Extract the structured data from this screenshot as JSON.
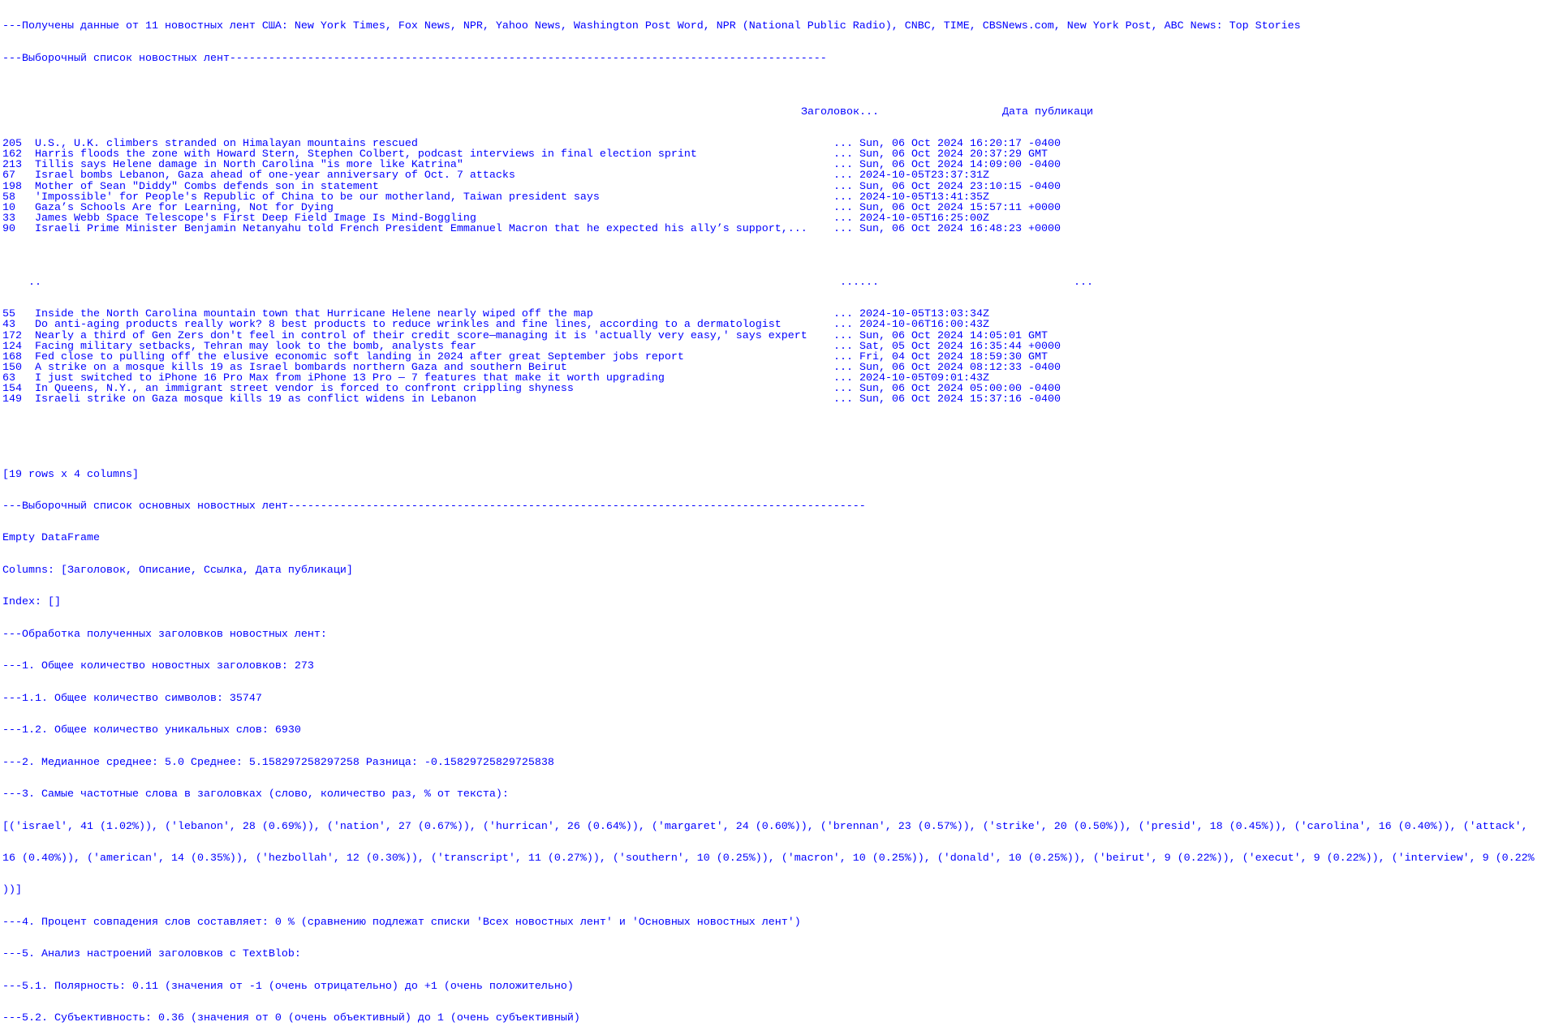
{
  "console": {
    "header_line": "---Получены данные от 11 новостных лент США: New York Times, Fox News, NPR, Yahoo News, Washington Post Word, NPR (National Public Radio), CNBC, TIME, CBSNews.com, New York Post, ABC News: Top Stories",
    "sample_list_title": "---Выборочный список новостных лент--------------------------------------------------------------------------------------------",
    "table": {
      "columns": {
        "title": "Заголовок",
        "ellipsis": "...",
        "date": "Дата публикаци"
      },
      "rows_top": [
        {
          "index": "205",
          "title": "U.S., U.K. climbers stranded on Himalayan mountains rescued",
          "ellipsis": "...",
          "date": "Sun, 06 Oct 2024 16:20:17 -0400"
        },
        {
          "index": "162",
          "title": "Harris floods the zone with Howard Stern, Stephen Colbert, podcast interviews in final election sprint",
          "ellipsis": "...",
          "date": "Sun, 06 Oct 2024 20:37:29 GMT"
        },
        {
          "index": "213",
          "title": "Tillis says Helene damage in North Carolina \"is more like Katrina\"",
          "ellipsis": "...",
          "date": "Sun, 06 Oct 2024 14:09:00 -0400"
        },
        {
          "index": "67",
          "title": "Israel bombs Lebanon, Gaza ahead of one-year anniversary of Oct. 7 attacks",
          "ellipsis": "...",
          "date": "2024-10-05T23:37:31Z"
        },
        {
          "index": "198",
          "title": "Mother of Sean \"Diddy\" Combs defends son in statement",
          "ellipsis": "...",
          "date": "Sun, 06 Oct 2024 23:10:15 -0400"
        },
        {
          "index": "58",
          "title": "'Impossible' for People's Republic of China to be our motherland, Taiwan president says",
          "ellipsis": "...",
          "date": "2024-10-05T13:41:35Z"
        },
        {
          "index": "10",
          "title": "Gaza’s Schools Are for Learning, Not for Dying",
          "ellipsis": "...",
          "date": "Sun, 06 Oct 2024 15:57:11 +0000"
        },
        {
          "index": "33",
          "title": "James Webb Space Telescope's First Deep Field Image Is Mind-Boggling",
          "ellipsis": "...",
          "date": "2024-10-05T16:25:00Z"
        },
        {
          "index": "90",
          "title": "Israeli Prime Minister Benjamin Netanyahu told French President Emmanuel Macron that he expected his ally’s support,...",
          "ellipsis": "...",
          "date": "Sun, 06 Oct 2024 16:48:23 +0000"
        }
      ],
      "gap_row": {
        "index": "..",
        "title": "...",
        "ellipsis": "...",
        "date": "..."
      },
      "rows_bottom": [
        {
          "index": "55",
          "title": "Inside the North Carolina mountain town that Hurricane Helene nearly wiped off the map",
          "ellipsis": "...",
          "date": "2024-10-05T13:03:34Z"
        },
        {
          "index": "43",
          "title": "Do anti-aging products really work? 8 best products to reduce wrinkles and fine lines, according to a dermatologist",
          "ellipsis": "...",
          "date": "2024-10-06T16:00:43Z"
        },
        {
          "index": "172",
          "title": "Nearly a third of Gen Zers don't feel in control of their credit score—managing it is 'actually very easy,' says expert",
          "ellipsis": "...",
          "date": "Sun, 06 Oct 2024 14:05:01 GMT"
        },
        {
          "index": "124",
          "title": "Facing military setbacks, Tehran may look to the bomb, analysts fear",
          "ellipsis": "...",
          "date": "Sat, 05 Oct 2024 16:35:44 +0000"
        },
        {
          "index": "168",
          "title": "Fed close to pulling off the elusive economic soft landing in 2024 after great September jobs report",
          "ellipsis": "...",
          "date": "Fri, 04 Oct 2024 18:59:30 GMT"
        },
        {
          "index": "150",
          "title": "A strike on a mosque kills 19 as Israel bombards northern Gaza and southern Beirut",
          "ellipsis": "...",
          "date": "Sun, 06 Oct 2024 08:12:33 -0400"
        },
        {
          "index": "63",
          "title": "I just switched to iPhone 16 Pro Max from iPhone 13 Pro — 7 features that make it worth upgrading",
          "ellipsis": "...",
          "date": "2024-10-05T09:01:43Z"
        },
        {
          "index": "154",
          "title": "In Queens, N.Y., an immigrant street vendor is forced to confront crippling shyness",
          "ellipsis": "...",
          "date": "Sun, 06 Oct 2024 05:00:00 -0400"
        },
        {
          "index": "149",
          "title": "Israeli strike on Gaza mosque kills 19 as conflict widens in Lebanon",
          "ellipsis": "...",
          "date": "Sun, 06 Oct 2024 15:37:16 -0400"
        }
      ],
      "shape": "[19 rows x 4 columns]"
    },
    "main_list_title": "---Выборочный список основных новостных лент-----------------------------------------------------------------------------------------",
    "empty_df": "Empty DataFrame",
    "empty_df_columns": "Columns: [Заголовок, Описание, Ссылка, Дата публикаци]",
    "empty_df_index": "Index: []",
    "processing_title": "---Обработка полученных заголовков новостных лент:",
    "stats": {
      "total_headlines": "---1. Общее количество новостных заголовков: 273",
      "total_chars": "---1.1. Общее количество символов: 35747",
      "unique_words": "---1.2. Общее количество уникальных слов: 6930",
      "median_mean": "---2. Медианное среднее: 5.0 Среднее: 5.158297258297258 Разница: -0.15829725829725838",
      "top_words_title": "---3. Самые частотные слова в заголовках (слово, количество раз, % от текста):",
      "top_words_line1": "[('israel', 41 (1.02%)), ('lebanon', 28 (0.69%)), ('nation', 27 (0.67%)), ('hurrican', 26 (0.64%)), ('margaret', 24 (0.60%)), ('brennan', 23 (0.57%)), ('strike', 20 (0.50%)), ('presid', 18 (0.45%)), ('carolina', 16 (0.40%)), ('attack',",
      "top_words_line2": "16 (0.40%)), ('american', 14 (0.35%)), ('hezbollah', 12 (0.30%)), ('transcript', 11 (0.27%)), ('southern', 10 (0.25%)), ('macron', 10 (0.25%)), ('donald', 10 (0.25%)), ('beirut', 9 (0.22%)), ('execut', 9 (0.22%)), ('interview', 9 (0.22%",
      "top_words_line3": "))]",
      "overlap": "---4. Процент совпадения слов составляет: 0 % (сравнению подлежат списки 'Всех новостных лент' и 'Основных новостных лент')",
      "sentiment_title": "---5. Анализ настроений заголовков с TextBlob:",
      "polarity": "---5.1. Полярность: 0.11 (значения от -1 (очень отрицательно) до +1 (очень положительно)",
      "subjectivity": "---5.2. Субъективность: 0.36 (значения от 0 (очень объективный) до 1 (очень субъективный)"
    },
    "text_color": "#0000ff"
  }
}
